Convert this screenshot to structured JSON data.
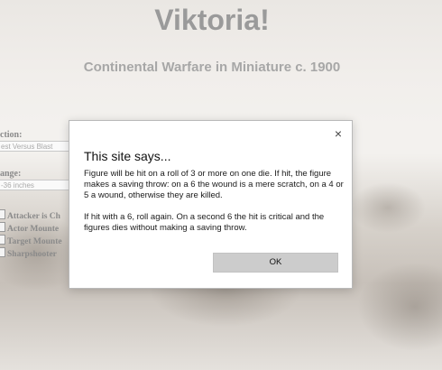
{
  "page": {
    "title": "Viktoria!",
    "subtitle": "Continental Warfare in Miniature c. 1900",
    "form": {
      "action_label": "ction:",
      "action_value": "est Versus Blast",
      "range_label": "ange:",
      "range_value": "-36 inches",
      "checkboxes": [
        {
          "label": "Attacker is Ch"
        },
        {
          "label": "Actor Mounte"
        },
        {
          "label": "Target Mounte"
        },
        {
          "label": "Sharpshooter"
        }
      ]
    }
  },
  "dialog": {
    "title": "This site says...",
    "close_glyph": "×",
    "paragraphs": [
      "Figure will be hit on a roll of 3 or more on one die. If hit, the figure makes a saving throw: on a 6 the wound is a mere scratch, on a 4 or 5 a wound, otherwise they are killed.",
      "If hit with a 6, roll again. On a second 6 the hit is critical and the figures dies without making a saving throw."
    ],
    "ok_label": "OK"
  }
}
